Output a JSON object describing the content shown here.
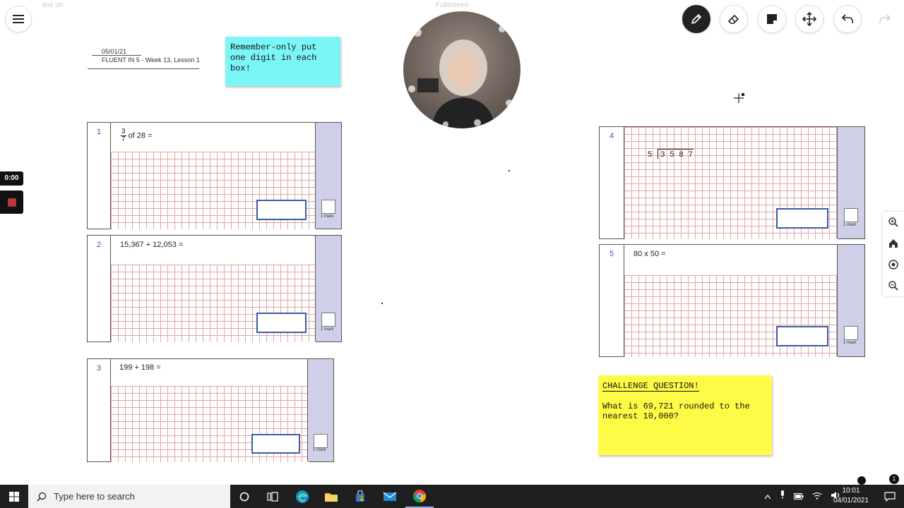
{
  "topbar": {
    "menu_icon": "hamburger-icon",
    "line_on_label": "line on",
    "fullscreen_label": "Fullscreen"
  },
  "toolbar": {
    "tools": [
      {
        "name": "pen-icon",
        "active": true
      },
      {
        "name": "eraser-icon",
        "active": false
      },
      {
        "name": "sticky-note-icon",
        "active": false
      },
      {
        "name": "move-icon",
        "active": false
      },
      {
        "name": "undo-icon",
        "active": false
      },
      {
        "name": "redo-icon",
        "active": false
      }
    ]
  },
  "header": {
    "date": "05/01/21",
    "title": "FLUENT IN 5 - Week 13, Lesson 1"
  },
  "notes": {
    "reminder": "Remember-only put one digit in each box!",
    "challenge_heading": "CHALLENGE QUESTION!",
    "challenge_text": "What is 69,721 rounded to the nearest 10,000?"
  },
  "questions": [
    {
      "number": "1",
      "fraction_num": "3",
      "fraction_den": "7",
      "text": "of 28 =",
      "mark_label": "1 mark"
    },
    {
      "number": "2",
      "text": "15,367 + 12,053 =",
      "mark_label": "1 mark"
    },
    {
      "number": "3",
      "text": "199 + 198 =",
      "mark_label": "1 mark"
    },
    {
      "number": "4",
      "divisor": "5",
      "dividend_digits": [
        "3",
        "5",
        "8",
        "7"
      ],
      "mark_label": "1 mark"
    },
    {
      "number": "5",
      "text": "80 x 50 =",
      "mark_label": "1 mark"
    }
  ],
  "recording": {
    "timer": "0:00"
  },
  "side_controls": [
    "zoom-in-icon",
    "home-icon",
    "target-icon",
    "zoom-out-icon"
  ],
  "taskbar": {
    "search_placeholder": "Type here to search",
    "time": "10:01",
    "date": "04/01/2021",
    "notification_count": "1"
  },
  "colors": {
    "cyan_note": "#7cf5f7",
    "yellow_note": "#fdfb46",
    "grid_line": "#e3a5a5",
    "mark_column": "#cfd0e8",
    "answer_box": "#3a5ba8"
  }
}
